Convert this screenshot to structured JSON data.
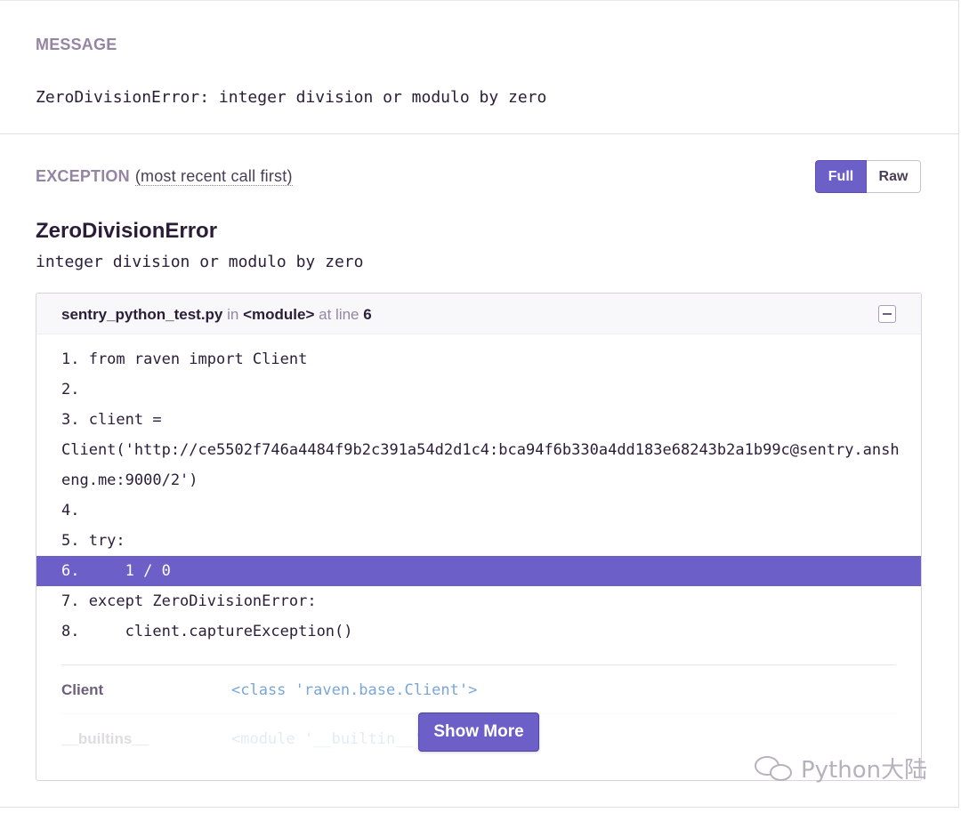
{
  "message": {
    "heading": "MESSAGE",
    "text": "ZeroDivisionError: integer division or modulo by zero"
  },
  "exception": {
    "heading": "EXCEPTION",
    "subheading": "(most recent call first)",
    "toggle": {
      "full": "Full",
      "raw": "Raw",
      "selected": "Full"
    },
    "type": "ZeroDivisionError",
    "value": "integer division or modulo by zero"
  },
  "frame": {
    "filename": "sentry_python_test.py",
    "in_label": "in",
    "function": "<module>",
    "at_line_label": "at line",
    "line_no": "6",
    "code_lines": [
      {
        "text": "1. from raven import Client",
        "active": false
      },
      {
        "text": "2.",
        "active": false
      },
      {
        "text": "3. client =",
        "active": false
      },
      {
        "text": "Client('http://ce5502f746a4484f9b2c391a54d2d1c4:bca94f6b330a4dd183e68243b2a1b99c@sentry.ansh",
        "active": false
      },
      {
        "text": "eng.me:9000/2')",
        "active": false
      },
      {
        "text": "4.",
        "active": false
      },
      {
        "text": "5. try:",
        "active": false
      },
      {
        "text": "6.     1 / 0",
        "active": true
      },
      {
        "text": "7. except ZeroDivisionError:",
        "active": false
      },
      {
        "text": "8.     client.captureException()",
        "active": false
      }
    ],
    "vars": [
      {
        "key": "Client",
        "value": "<class 'raven.base.Client'>"
      },
      {
        "key": "__builtins__",
        "value": "<module '__builtin__'"
      }
    ],
    "show_more_label": "Show More"
  },
  "watermark": {
    "text": "Python大陆",
    "icon": "wechat-icon"
  },
  "colors": {
    "accent": "#6c5fc7",
    "heading": "#9585a3",
    "text": "#2b1d38",
    "var_value": "#7aa6d8"
  }
}
